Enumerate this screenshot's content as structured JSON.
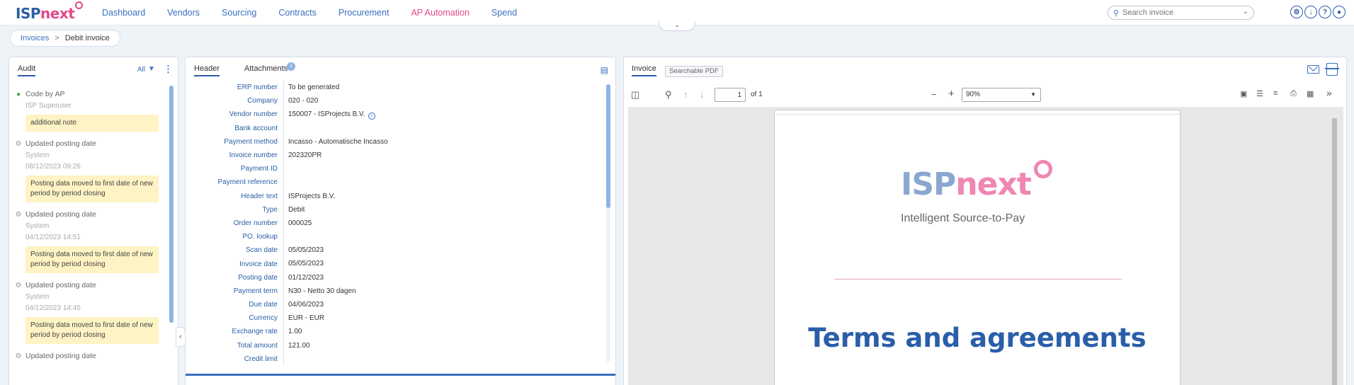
{
  "app": {
    "logo_isp": "ISP",
    "logo_next": "next"
  },
  "nav": {
    "items": [
      {
        "label": "Dashboard"
      },
      {
        "label": "Vendors"
      },
      {
        "label": "Sourcing"
      },
      {
        "label": "Contracts"
      },
      {
        "label": "Procurement"
      },
      {
        "label": "AP Automation"
      },
      {
        "label": "Spend"
      }
    ],
    "active": "AP Automation",
    "active_color": "#e5488a",
    "link_color": "#3b6fc0"
  },
  "search": {
    "placeholder": "Search invoice",
    "icon": "search-icon"
  },
  "top_icons": [
    "gear-icon",
    "download-icon",
    "help-icon",
    "user-icon"
  ],
  "breadcrumb": {
    "parent": "Invoices",
    "separator": ">",
    "current": "Debit invoice"
  },
  "audit": {
    "tab": "Audit",
    "filter_label": "All",
    "items": [
      {
        "icon": "user-icon",
        "title": "Code by AP",
        "user": "ISP Superuser",
        "date": "",
        "note": "additional note"
      },
      {
        "icon": "gear-icon",
        "title": "Updated posting date",
        "user": "System",
        "date": "08/12/2023 09:26",
        "note": "Posting data moved to first date of new period by period closing"
      },
      {
        "icon": "gear-icon",
        "title": "Updated posting date",
        "user": "System",
        "date": "04/12/2023 14:51",
        "note": "Posting data moved to first date of new period by period closing"
      },
      {
        "icon": "gear-icon",
        "title": "Updated posting date",
        "user": "System",
        "date": "04/12/2023 14:45",
        "note": "Posting data moved to first date of new period by period closing"
      },
      {
        "icon": "gear-icon",
        "title": "Updated posting date",
        "user": "",
        "date": "",
        "note": ""
      }
    ]
  },
  "header": {
    "tabs": [
      {
        "label": "Header"
      },
      {
        "label": "Attachments",
        "badge": "1"
      }
    ],
    "fields": [
      {
        "label": "ERP number",
        "value": "To be generated"
      },
      {
        "label": "Company",
        "value": "020 - 020"
      },
      {
        "label": "Vendor number",
        "value": "150007 - ISProjects B.V."
      },
      {
        "label": "Bank account",
        "value": ""
      },
      {
        "label": "Payment method",
        "value": "Incasso - Automatische Incasso"
      },
      {
        "label": "Invoice number",
        "value": "202320PR"
      },
      {
        "label": "Payment ID",
        "value": ""
      },
      {
        "label": "Payment reference",
        "value": ""
      },
      {
        "label": "Header text",
        "value": "ISProjects B.V."
      },
      {
        "label": "Type",
        "value": "Debit"
      },
      {
        "label": "Order number",
        "value": "000025"
      },
      {
        "label": "PO. lookup",
        "value": ""
      },
      {
        "label": "Scan date",
        "value": "05/05/2023"
      },
      {
        "label": "Invoice date",
        "value": "05/05/2023"
      },
      {
        "label": "Posting date",
        "value": "01/12/2023"
      },
      {
        "label": "Payment term",
        "value": "N30 - Netto 30 dagen"
      },
      {
        "label": "Due date",
        "value": "04/06/2023"
      },
      {
        "label": "Currency",
        "value": "EUR - EUR"
      },
      {
        "label": "Exchange rate",
        "value": "1.00"
      },
      {
        "label": "Total amount",
        "value": "121.00"
      },
      {
        "label": "Credit limit",
        "value": ""
      }
    ]
  },
  "invoice": {
    "tabs": [
      {
        "label": "Invoice"
      },
      {
        "label": "Searchable PDF"
      }
    ],
    "page_number": "1",
    "page_total": "of 1",
    "zoom": "90%",
    "document": {
      "logo_isp": "ISP",
      "logo_next": "next",
      "tagline": "Intelligent Source-to-Pay",
      "title": "Terms and agreements"
    }
  }
}
